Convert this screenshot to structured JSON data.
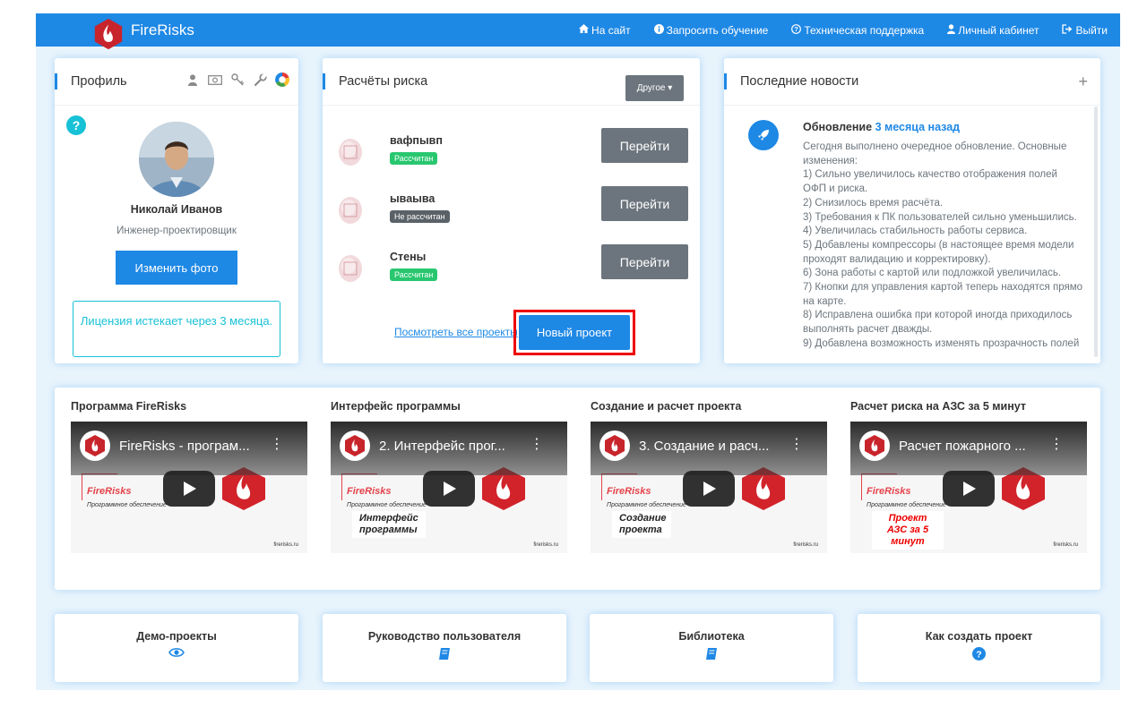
{
  "header": {
    "brand": "FireRisks",
    "nav": [
      {
        "label": "На сайт",
        "icon": "home-icon"
      },
      {
        "label": "Запросить обучение",
        "icon": "info-icon"
      },
      {
        "label": "Техническая поддержка",
        "icon": "question-circle-icon"
      },
      {
        "label": "Личный кабинет",
        "icon": "user-icon"
      },
      {
        "label": "Выйти",
        "icon": "sign-out-icon"
      }
    ]
  },
  "profile": {
    "title": "Профиль",
    "tools": [
      "user-icon",
      "money-icon",
      "key-icon",
      "wrench-icon",
      "color-wheel-icon"
    ],
    "name": "Николай Иванов",
    "role": "Инженер-проектировщик",
    "change_photo": "Изменить фото",
    "license": "Лицензия истекает через 3 месяца."
  },
  "risk": {
    "title": "Расчёты риска",
    "dropdown": "Другое",
    "projects": [
      {
        "name": "вафпывп",
        "status": "Рассчитан",
        "status_color": "#28c76f",
        "button": "Перейти"
      },
      {
        "name": "ываыва",
        "status": "Не рассчитан",
        "status_color": "#5a6268",
        "button": "Перейти"
      },
      {
        "name": "Стены",
        "status": "Рассчитан",
        "status_color": "#28c76f",
        "button": "Перейти"
      }
    ],
    "view_all": "Посмотреть все проекты",
    "new_project": "Новый проект"
  },
  "news": {
    "title": "Последние новости",
    "item_title": "Обновление",
    "item_time": "3 месяца назад",
    "body_lines": [
      "Сегодня выполнено очередное обновление. Основные",
      "изменения:",
      "1) Сильно увеличилось качество отображения полей",
      "ОФП и риска.",
      "2) Снизилось время расчёта.",
      "3) Требования к ПК пользователей сильно уменьшились.",
      "4) Увеличилась стабильность работы сервиса.",
      "5) Добавлены компрессоры (в настоящее время модели",
      "проходят валидацию и корректировку).",
      "6) Зона работы с картой или подложкой увеличилась.",
      "7) Кнопки для управления картой теперь находятся прямо",
      "на карте.",
      "8) Исправлена ошибка при которой иногда приходилось",
      "выполнять расчет дважды.",
      "9) Добавлена возможность изменять прозрачность полей"
    ]
  },
  "videos": [
    {
      "heading": "Программа FireRisks",
      "title": "FireRisks - програм...",
      "brand": "FireRisks",
      "subtitle": "Программное обеспечение",
      "caption": "",
      "caption_red": false,
      "site": "firerisks.ru"
    },
    {
      "heading": "Интерфейс программы",
      "title": "2. Интерфейс прог...",
      "brand": "FireRisks",
      "subtitle": "Программное обеспечение",
      "caption": "Интерфейс программы",
      "caption_red": false,
      "site": "firerisks.ru"
    },
    {
      "heading": "Создание и расчет проекта",
      "title": "3. Создание и расч...",
      "brand": "FireRisks",
      "subtitle": "Программное обеспечение",
      "caption": "Создание проекта",
      "caption_red": false,
      "site": "firerisks.ru"
    },
    {
      "heading": "Расчет риска на АЗС за 5 минут",
      "title": "Расчет пожарного ...",
      "brand": "FireRisks",
      "subtitle": "Программное обеспечение",
      "caption": "Проект АЗС за 5 минут",
      "caption_red": true,
      "site": "firerisks.ru"
    }
  ],
  "footer": [
    {
      "label": "Демо-проекты",
      "icon": "eye-icon"
    },
    {
      "label": "Руководство пользователя",
      "icon": "book-icon"
    },
    {
      "label": "Библиотека",
      "icon": "book-icon"
    },
    {
      "label": "Как создать проект",
      "icon": "question-circle-icon"
    }
  ],
  "colors": {
    "primary": "#1e88e5",
    "accent": "#17c1d6",
    "danger": "#e00000",
    "secondary": "#6c757d"
  }
}
